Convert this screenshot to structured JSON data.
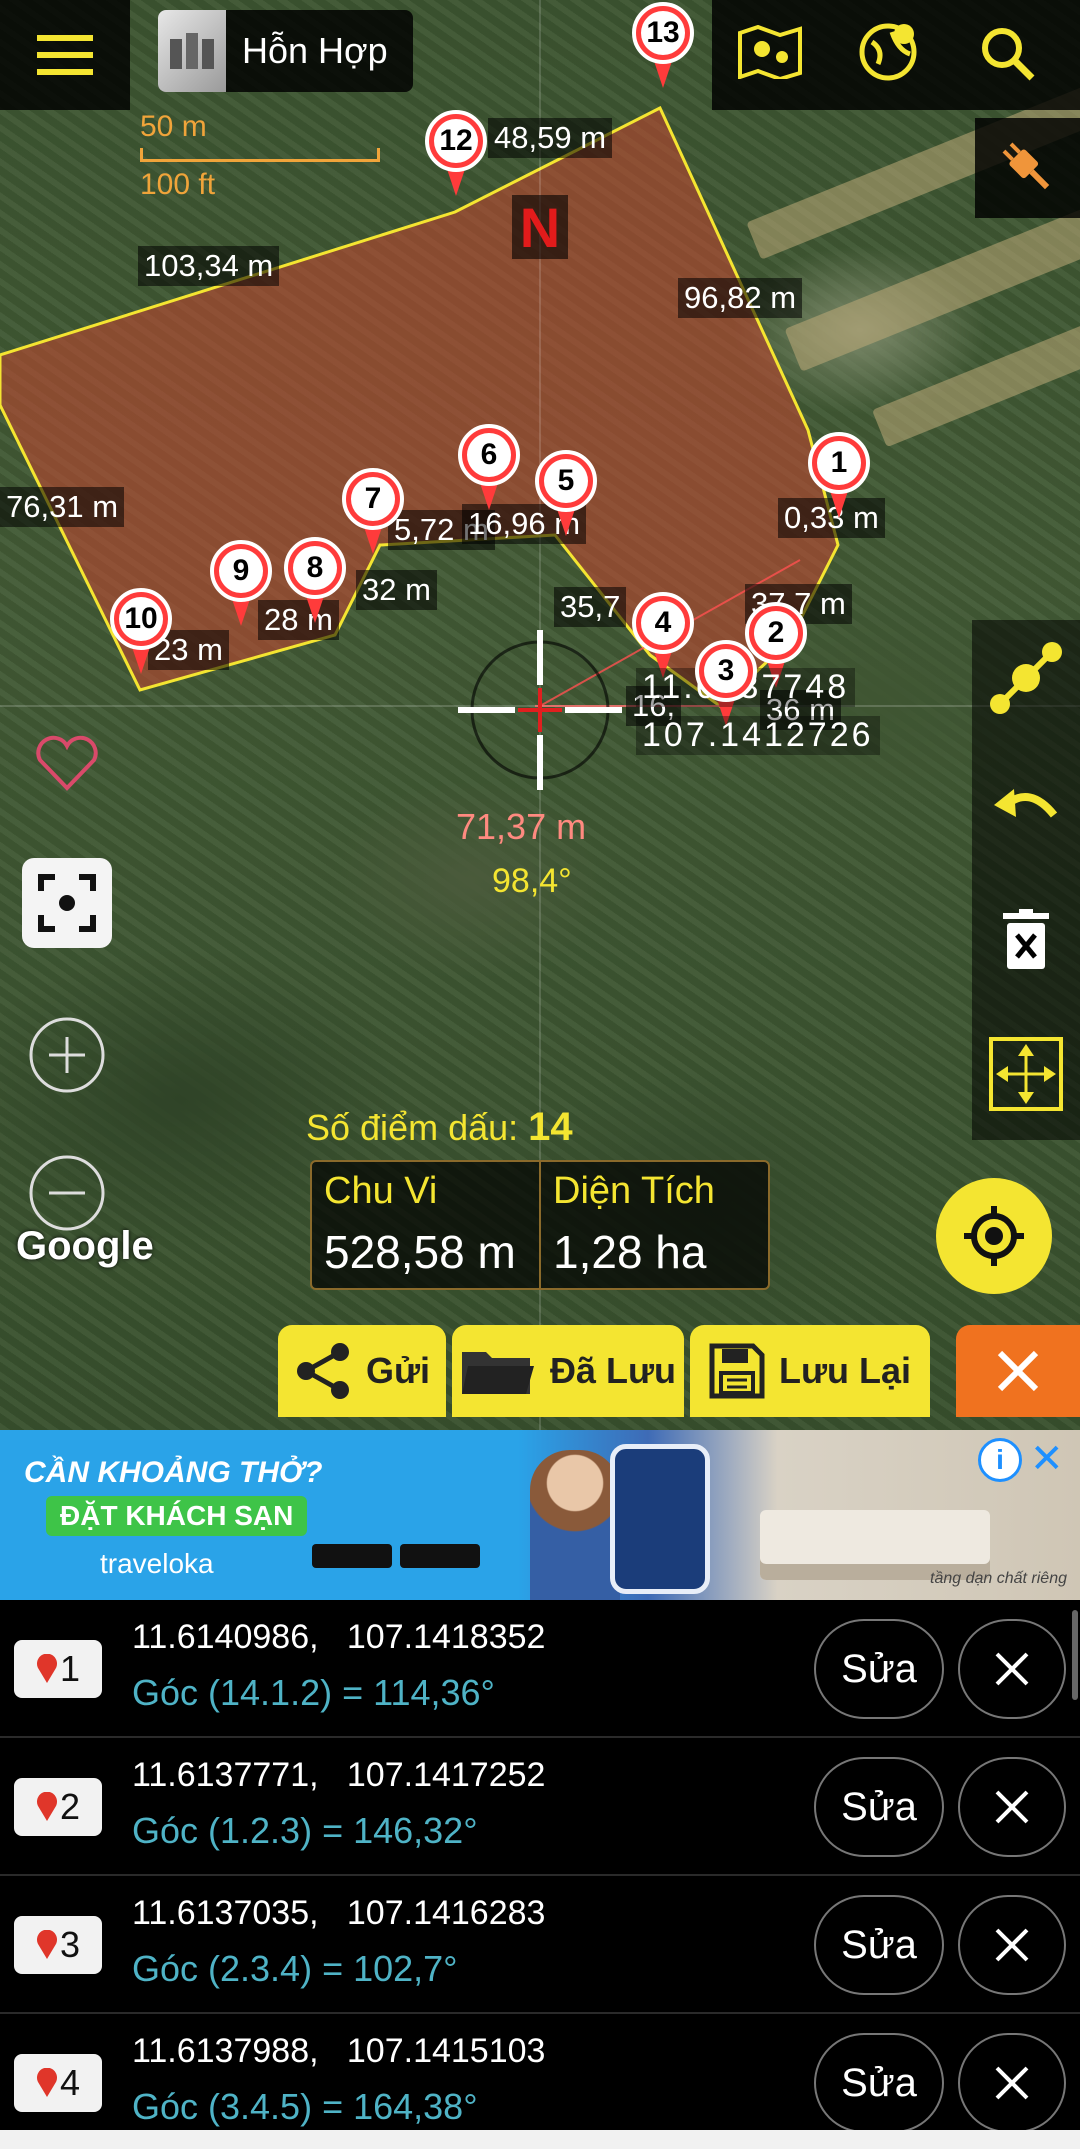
{
  "toolbar": {
    "map_type_label": "Hỗn Hợp"
  },
  "scale": {
    "metric": "50 m",
    "imperial": "100 ft"
  },
  "north_label": "N",
  "segment_labels": [
    "48,59 m",
    "103,34 m",
    "96,82 m",
    "76,31 m",
    "0,33 m",
    "5,72 m",
    "16,96 m",
    "32 m",
    "35,7",
    "37,7 m",
    "28 m",
    "23 m",
    "16,",
    "36 m"
  ],
  "markers": [
    "1",
    "2",
    "3",
    "4",
    "5",
    "6",
    "7",
    "8",
    "9",
    "10",
    "12",
    "13"
  ],
  "crosshair": {
    "lat": "11.6137748",
    "lon": "107.1412726",
    "distance": "71,37 m",
    "bearing": "98,4°"
  },
  "google_label": "Google",
  "stats": {
    "points_label": "Số điểm dấu:",
    "points_value": "14",
    "perimeter_label": "Chu Vi",
    "perimeter_value": "528,58 m",
    "area_label": "Diện Tích",
    "area_value": "1,28 ha"
  },
  "actions": {
    "share": "Gửi",
    "saved": "Đã Lưu",
    "save": "Lưu Lại"
  },
  "ad": {
    "headline": "CẦN KHOẢNG THỞ?",
    "cta": "ĐẶT KHÁCH SẠN",
    "brand": "traveloka",
    "tagline": "tầng dạn chất riêng"
  },
  "points": [
    {
      "num": "1",
      "coords": "11.6140986,   107.1418352",
      "angle": "Góc (14.1.2) = 114,36°",
      "edit": "Sửa"
    },
    {
      "num": "2",
      "coords": "11.6137771,   107.1417252",
      "angle": "Góc (1.2.3) = 146,32°",
      "edit": "Sửa"
    },
    {
      "num": "3",
      "coords": "11.6137035,   107.1416283",
      "angle": "Góc (2.3.4) = 102,7°",
      "edit": "Sửa"
    },
    {
      "num": "4",
      "coords": "11.6137988,   107.1415103",
      "angle": "Góc (3.4.5) = 164,38°",
      "edit": "Sửa"
    }
  ]
}
